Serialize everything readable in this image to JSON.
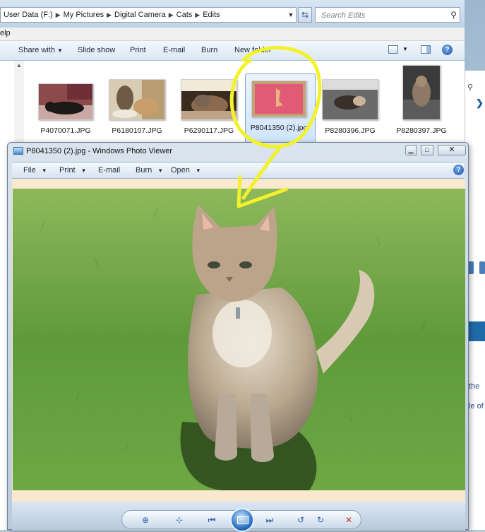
{
  "explorer": {
    "breadcrumb": [
      "User Data (F:)",
      "My Pictures",
      "Digital Camera",
      "Cats",
      "Edits"
    ],
    "search_placeholder": "Search Edits",
    "menu_partial": "elp",
    "toolbar": {
      "share_with": "Share with",
      "slide_show": "Slide show",
      "print": "Print",
      "email": "E-mail",
      "burn": "Burn",
      "new_folder": "New folder"
    },
    "thumbnails": [
      {
        "name": "P4070071.JPG"
      },
      {
        "name": "P6180107.JPG"
      },
      {
        "name": "P6290117.JPG"
      },
      {
        "name": "P8041350 (2).jpg",
        "selected": true
      },
      {
        "name": "P8280396.JPG"
      },
      {
        "name": "P8280397.JPG"
      }
    ]
  },
  "right_strip": {
    "text1": "the",
    "text2": "le of"
  },
  "viewer": {
    "title": "P8041350 (2).jpg - Windows Photo Viewer",
    "menu": {
      "file": "File",
      "print": "Print",
      "email": "E-mail",
      "burn": "Burn",
      "open": "Open"
    }
  },
  "colors": {
    "annotation": "#f2f22c",
    "selection": "#cfe4fa",
    "canvas": "#fae9cf",
    "grass": "#5f9a3a"
  }
}
